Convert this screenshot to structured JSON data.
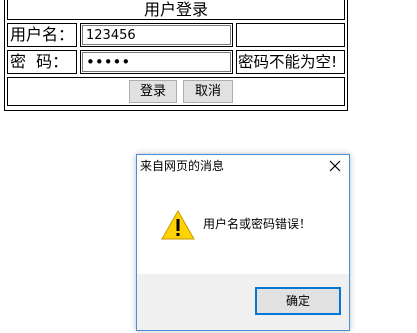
{
  "form": {
    "title": "用户登录",
    "username_label": "用户名：",
    "username_value": "123456",
    "username_message": "",
    "password_label": "密  码：",
    "password_value": "12345",
    "password_message": "密码不能为空!",
    "login_button": "登录",
    "cancel_button": "取消"
  },
  "dialog": {
    "title": "来自网页的消息",
    "message": "用户名或密码错误！",
    "ok_button": "确定",
    "close_icon": "close-icon",
    "message_icon": "warning-icon"
  },
  "colors": {
    "dialog_border": "#4a90d9",
    "ok_button_border": "#0078d7",
    "warning_fill": "#ffd200",
    "footer_background": "#f0f0f0"
  }
}
